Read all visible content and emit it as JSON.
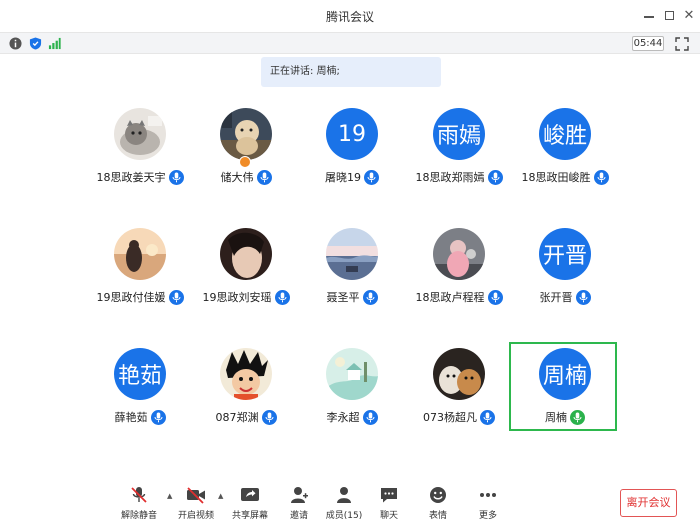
{
  "window": {
    "title": "腾讯会议"
  },
  "infobar": {
    "timer": "05:44"
  },
  "speaking": {
    "label": "正在讲话: 周楠;"
  },
  "participants": [
    {
      "name": "18思政姜天宇",
      "avatar_text": "",
      "avatar_kind": "cat",
      "mic_color": "blue"
    },
    {
      "name": "储大伟",
      "avatar_text": "",
      "avatar_kind": "dog",
      "mic_color": "blue"
    },
    {
      "name": "屠晓19",
      "avatar_text": "19",
      "avatar_kind": "text",
      "mic_color": "blue"
    },
    {
      "name": "18思政郑雨嫣",
      "avatar_text": "雨嫣",
      "avatar_kind": "text",
      "mic_color": "blue"
    },
    {
      "name": "18思政田峻胜",
      "avatar_text": "峻胜",
      "avatar_kind": "text",
      "mic_color": "blue"
    },
    {
      "name": "19思政付佳媛",
      "avatar_text": "",
      "avatar_kind": "sunset",
      "mic_color": "blue"
    },
    {
      "name": "19思政刘安瑶",
      "avatar_text": "",
      "avatar_kind": "portrait",
      "mic_color": "blue"
    },
    {
      "name": "聂圣平",
      "avatar_text": "",
      "avatar_kind": "sea",
      "mic_color": "blue"
    },
    {
      "name": "18思政卢程程",
      "avatar_text": "",
      "avatar_kind": "girl",
      "mic_color": "blue"
    },
    {
      "name": "张开晋",
      "avatar_text": "开晋",
      "avatar_kind": "text",
      "mic_color": "blue"
    },
    {
      "name": "薛艳茹",
      "avatar_text": "艳茹",
      "avatar_kind": "text",
      "mic_color": "blue"
    },
    {
      "name": "087郑渊",
      "avatar_text": "",
      "avatar_kind": "cartoon",
      "mic_color": "blue"
    },
    {
      "name": "李永超",
      "avatar_text": "",
      "avatar_kind": "illustration",
      "mic_color": "blue"
    },
    {
      "name": "073杨超凡",
      "avatar_text": "",
      "avatar_kind": "dogs",
      "mic_color": "blue"
    },
    {
      "name": "周楠",
      "avatar_text": "周楠",
      "avatar_kind": "text",
      "mic_color": "green"
    }
  ],
  "toolbar": {
    "unmute": "解除静音",
    "start_video": "开启视频",
    "share_screen": "共享屏幕",
    "invite": "邀请",
    "members": "成员(15)",
    "chat": "聊天",
    "emoji": "表情",
    "more": "更多",
    "leave": "离开会议"
  },
  "colors": {
    "accent": "#1a73e8",
    "speaking_bg": "#e6eefb",
    "active_border": "#2db84d",
    "leave_red": "#e02e2e"
  }
}
